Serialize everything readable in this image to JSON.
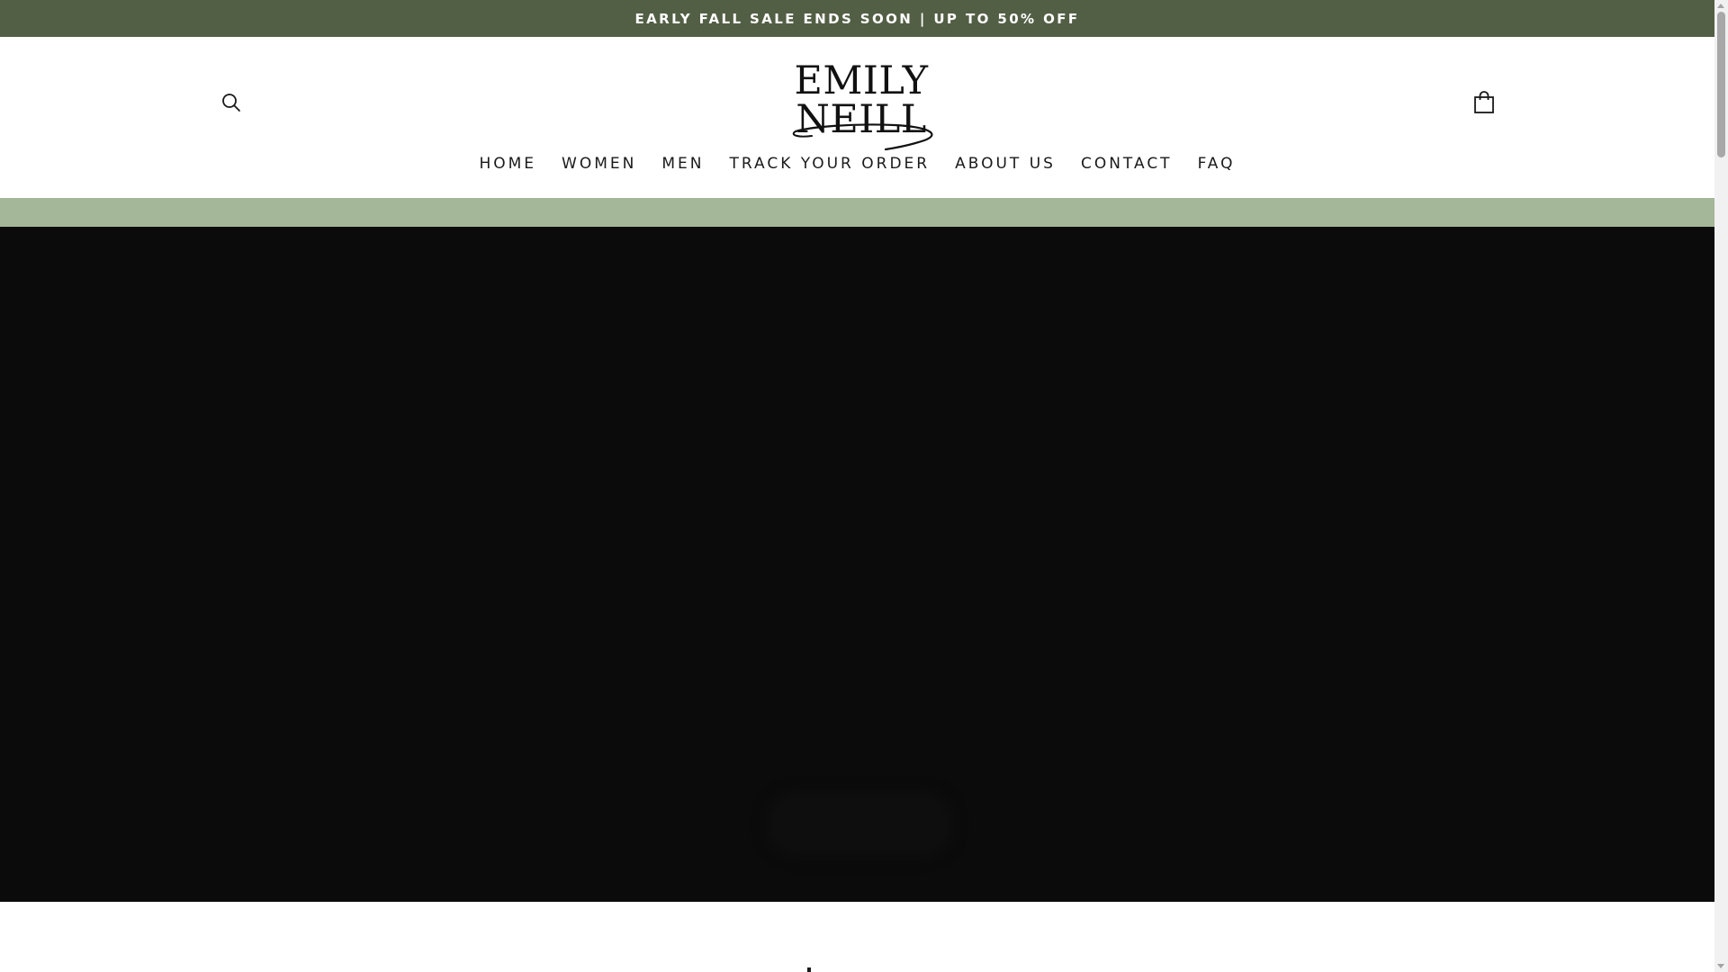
{
  "announcement": {
    "text": "EARLY FALL SALE ENDS SOON | UP TO 50% OFF",
    "background": "#535f45",
    "color": "#ffffff"
  },
  "header": {
    "search_icon": "search-icon",
    "cart_icon": "shopping-bag-icon",
    "logo": {
      "text": "EMILY NEILL"
    }
  },
  "nav": {
    "items": [
      {
        "label": "HOME"
      },
      {
        "label": "WOMEN"
      },
      {
        "label": "MEN"
      },
      {
        "label": "TRACK YOUR ORDER"
      },
      {
        "label": "ABOUT US"
      },
      {
        "label": "CONTACT"
      },
      {
        "label": "FAQ"
      }
    ]
  },
  "promo_strip": {
    "background": "#a4b799"
  },
  "hero": {
    "background": "#0b0b0b",
    "button_label": ""
  },
  "colors": {
    "accent": "#535f45",
    "sage": "#a4b799",
    "text": "#1a1a1a"
  }
}
